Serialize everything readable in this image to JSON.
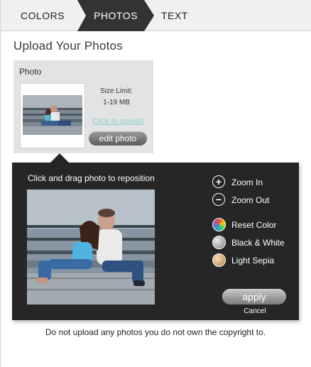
{
  "tabs": {
    "colors": "COLORS",
    "photos": "PHOTOS",
    "text": "TEXT",
    "active": "PHOTOS",
    "active_color": "#333333"
  },
  "page": {
    "title": "Upload Your Photos"
  },
  "photo_box": {
    "label": "Photo",
    "size_limit_label": "Size Limit:",
    "size_limit_value": "1-19 MB",
    "upload_link": "Click to upload",
    "edit_button": "edit photo"
  },
  "editor": {
    "hint": "Click and drag photo to reposition",
    "tools": {
      "zoom_in": "Zoom In",
      "zoom_out": "Zoom Out",
      "reset_color": "Reset Color",
      "black_white": "Black & White",
      "light_sepia": "Light Sepia"
    },
    "apply_button": "apply",
    "cancel_link": "Cancel",
    "colors": {
      "panel": "#262626",
      "upload_link": "#8fd0cf"
    }
  },
  "footer": {
    "disclaimer": "Do not upload any photos you do not own the copyright to."
  }
}
